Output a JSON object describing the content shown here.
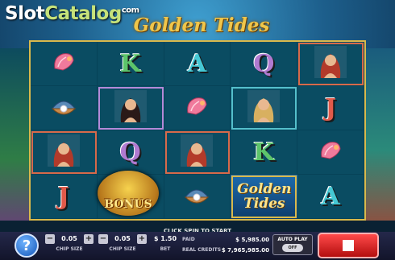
{
  "watermark": {
    "part1": "Slot",
    "part2": "Catalog",
    "suffix": "com"
  },
  "game": {
    "logo_text": "Golden Tides"
  },
  "reels": [
    [
      {
        "type": "shell",
        "icon": "pink-conch-shell-icon"
      },
      {
        "type": "letter",
        "symbol": "K",
        "cls": "k"
      },
      {
        "type": "letter",
        "symbol": "A",
        "cls": "a"
      },
      {
        "type": "letter",
        "symbol": "Q",
        "cls": "q"
      },
      {
        "type": "mermaid",
        "icon": "red-hair-mermaid-icon",
        "frame": "frame-mermaid3"
      }
    ],
    [
      {
        "type": "clam",
        "icon": "pearl-clam-icon"
      },
      {
        "type": "mermaid",
        "icon": "dark-hair-mermaid-icon",
        "frame": "frame-mermaid"
      },
      {
        "type": "shell",
        "icon": "pink-conch-shell-icon"
      },
      {
        "type": "mermaid",
        "icon": "blonde-mermaid-icon",
        "frame": "frame-mermaid2"
      },
      {
        "type": "letter",
        "symbol": "J",
        "cls": "j"
      }
    ],
    [
      {
        "type": "mermaid",
        "icon": "red-hair-mermaid-icon",
        "frame": "frame-mermaid3"
      },
      {
        "type": "letter",
        "symbol": "Q",
        "cls": "q"
      },
      {
        "type": "mermaid",
        "icon": "red-hair-mermaid-icon",
        "frame": "frame-mermaid3"
      },
      {
        "type": "letter",
        "symbol": "K",
        "cls": "k"
      },
      {
        "type": "shell",
        "icon": "pink-conch-shell-icon"
      }
    ],
    [
      {
        "type": "letter",
        "symbol": "J",
        "cls": "j"
      },
      {
        "type": "bonus-slot"
      },
      {
        "type": "clam",
        "icon": "pearl-clam-icon"
      },
      {
        "type": "golden-tides"
      },
      {
        "type": "letter",
        "symbol": "A",
        "cls": "a"
      }
    ]
  ],
  "bonus": {
    "label": "BONUS"
  },
  "golden_tides_symbol": {
    "line1": "Golden",
    "line2": "Tides"
  },
  "status": {
    "message": "CLICK SPIN TO START"
  },
  "controls": {
    "info_glyph": "?",
    "chip_size_1": {
      "value": "0.05",
      "label": "CHIP SIZE"
    },
    "chip_size_2": {
      "value": "0.05",
      "label": "CHIP SIZE"
    },
    "bet": {
      "value": "$ 1.50",
      "label": "BET"
    },
    "paid": {
      "label": "PAID",
      "value": "$ 5,985.00"
    },
    "real_credits": {
      "label": "REAL CREDITS",
      "value": "$ 7,965,985.00"
    },
    "autoplay": {
      "label": "AUTO PLAY",
      "state": "OFF"
    },
    "minus_glyph": "−",
    "plus_glyph": "+"
  },
  "colors": {
    "reel_frame": "#d9b94b",
    "spin_button": "#d81b1b",
    "panel": "#1b1e3a"
  }
}
